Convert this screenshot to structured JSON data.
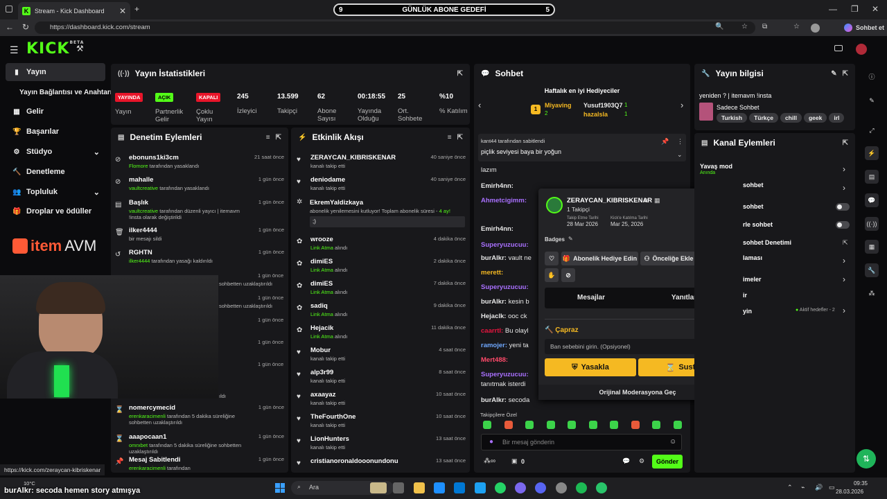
{
  "browser": {
    "tab_title": "Stream - Kick Dashboard",
    "url": "https://dashboard.kick.com/stream",
    "profile_label": "Sohbet et",
    "goal": {
      "left": "9",
      "title": "GÜNLÜK ABONE GEDEFİ",
      "right": "5"
    },
    "status_link": "https://kick.com/zeraycan-kibriskenar"
  },
  "header": {
    "logo": "KICK",
    "beta": "BETA"
  },
  "sidebar": {
    "items": [
      {
        "label": "Yayın",
        "icon": "broadcast-icon"
      },
      {
        "label": "Yayın Bağlantısı ve Anahtarı",
        "icon": ""
      },
      {
        "label": "Gelir",
        "icon": "revenue-icon"
      },
      {
        "label": "Başarılar",
        "icon": "trophy-icon"
      },
      {
        "label": "Stüdyo",
        "icon": "studio-icon"
      },
      {
        "label": "Denetleme",
        "icon": "hammer-icon"
      },
      {
        "label": "Topluluk",
        "icon": "community-icon"
      },
      {
        "label": "Droplar ve ödüller",
        "icon": "gift-icon"
      }
    ],
    "brand_pre": "item",
    "brand_post": "AVM"
  },
  "stats": {
    "title": "Yayın İstatistikleri",
    "items": [
      {
        "badge": "YAYINDA",
        "label": "Yayın"
      },
      {
        "badge": "AÇIK",
        "label": "Partnerlik Gelir"
      },
      {
        "badge": "KAPALI",
        "label": "Çoklu Yayın"
      },
      {
        "value": "245",
        "label": "İzleyici"
      },
      {
        "value": "13.599",
        "label": "Takipçi"
      },
      {
        "value": "62",
        "label": "Abone Sayısı"
      },
      {
        "value": "00:18:55",
        "label": "Yayında Olduğu"
      },
      {
        "value": "25",
        "label": "Ort. Sohbete"
      },
      {
        "value": "%10",
        "label": "% Katılım"
      }
    ]
  },
  "moderation": {
    "title": "Denetim Eylemleri",
    "rows": [
      {
        "name": "ebonuns1ki3cm",
        "by": "Flomore",
        "rest": "tarafından yasaklandı",
        "time": "21 saat önce",
        "icon": "ban-icon"
      },
      {
        "name": "mahalle",
        "by": "vaultcreative",
        "rest": "tarafından yasaklandı",
        "time": "1 gün önce",
        "icon": "ban-icon"
      },
      {
        "name": "Başlık",
        "by": "vaultcreative",
        "rest": "tarafından düzenli yayıcı | itemavm !insta olarak değiştirildi",
        "time": "1 gün önce",
        "icon": "title-icon"
      },
      {
        "name": "ilker4444",
        "by": "",
        "rest": "bir mesajı sildi",
        "time": "1 gün önce",
        "icon": "trash-icon"
      },
      {
        "name": "RGHTN",
        "by": "ilker4444",
        "rest": "tarafından yasağı kaldırıldı",
        "time": "1 gün önce",
        "icon": "unban-icon"
      },
      {
        "name": "nomercymecid",
        "by": "erenkaracimenli",
        "rest": "tarafından 5 dakika süreliğine sohbetten uzaklaştırıldı",
        "time": "1 gün önce",
        "icon": "hourglass-icon"
      },
      {
        "name": "aaapocaan1",
        "by": "omrxbet",
        "rest": "tarafından 5 dakika süreliğine sohbetten uzaklaştırıldı",
        "time": "1 gün önce",
        "icon": "hourglass-icon"
      },
      {
        "name": "Mesaj Sabitlendi",
        "by": "erenkaracimenli",
        "rest": "tarafından",
        "time": "1 gün önce",
        "icon": "pin-icon"
      }
    ],
    "partial_times": [
      "1 gün önce",
      "1 gün önce",
      "1 gün önce",
      "1 gün önce",
      "1 gün önce"
    ],
    "partial_texts": [
      "sohbetten uzaklaştırıldı",
      "sohbetten uzaklaştırıldı",
      "ıldı"
    ]
  },
  "activity": {
    "title": "Etkinlik Akışı",
    "rows": [
      {
        "name": "ZERAYCAN_KIBRISKENAR",
        "sub": "kanalı takip etti",
        "time": "40 saniye önce",
        "icon": "heart-icon",
        "green": false
      },
      {
        "name": "deniodame",
        "sub": "kanalı takip etti",
        "time": "40 saniye önce",
        "icon": "heart-icon",
        "green": false
      },
      {
        "name": "wrooze",
        "sub": "Link Atma",
        "sub2": "alındı",
        "time": "4 dakika önce",
        "icon": "redeem-icon",
        "green": true
      },
      {
        "name": "dimiES",
        "sub": "Link Atma",
        "sub2": "alındı",
        "time": "2 dakika önce",
        "icon": "redeem-icon",
        "green": true
      },
      {
        "name": "dimiES",
        "sub": "Link Atma",
        "sub2": "alındı",
        "time": "7 dakika önce",
        "icon": "redeem-icon",
        "green": true
      },
      {
        "name": "sadiq",
        "sub": "Link Atma",
        "sub2": "alındı",
        "time": "9 dakika önce",
        "icon": "redeem-icon",
        "green": true
      },
      {
        "name": "Hejacik",
        "sub": "Link Atma",
        "sub2": "alındı",
        "time": "11 dakika önce",
        "icon": "redeem-icon",
        "green": true
      },
      {
        "name": "Mobur",
        "sub": "kanalı takip etti",
        "time": "4 saat önce",
        "icon": "heart-icon",
        "green": false
      },
      {
        "name": "alp3r99",
        "sub": "kanalı takip etti",
        "time": "8 saat önce",
        "icon": "heart-icon",
        "green": false
      },
      {
        "name": "axaayaz",
        "sub": "kanalı takip etti",
        "time": "10 saat önce",
        "icon": "heart-icon",
        "green": false
      },
      {
        "name": "TheFourthOne",
        "sub": "kanalı takip etti",
        "time": "10 saat önce",
        "icon": "heart-icon",
        "green": false
      },
      {
        "name": "LionHunters",
        "sub": "kanalı takip etti",
        "time": "13 saat önce",
        "icon": "heart-icon",
        "green": false
      },
      {
        "name": "cristianoronaldooonundonu",
        "sub": "",
        "time": "13 saat önce",
        "icon": "heart-icon",
        "green": false
      }
    ],
    "sub_event": {
      "name": "EkremYaldizkaya",
      "text": "abonelik yenilemesini kutluyor! Toplam abonelik süresi -",
      "months": "4 ay!",
      "message": ";)"
    }
  },
  "chat": {
    "title": "Sohbet",
    "gifters_title": "Haftalık en iyi Hediyeciler",
    "gifters": [
      {
        "name": "Miyaving",
        "count": "2"
      },
      {
        "name": "Yusuf1903Q7",
        "count": "1"
      },
      {
        "name": "hazalsla",
        "count": "1"
      }
    ],
    "pinned_by": "kant44 tarafından sabitlendi",
    "pinned_msg": "piçlik seviyesi baya bir yoğun",
    "lines": [
      {
        "user": "",
        "text": "lazım",
        "color": "#e8e8e8"
      },
      {
        "user": "Emirh4nn:",
        "text": "",
        "color": "#e8e8e8"
      },
      {
        "user": "Ahmetcigimm:",
        "text": "",
        "color": "#a970ff"
      },
      {
        "user": "",
        "text": "",
        "color": "#e8e8e8"
      },
      {
        "user": "Emirh4nn:",
        "text": "",
        "color": "#e8e8e8"
      },
      {
        "user": "Superyuzucuu:",
        "text": "",
        "color": "#a970ff"
      },
      {
        "user": "burAlkr:",
        "text": "vault ne",
        "color": "#e8e8e8"
      },
      {
        "user": "merett:",
        "text": "",
        "color": "#f5b922"
      },
      {
        "user": "Superyuzucuu:",
        "text": "",
        "color": "#a970ff"
      },
      {
        "user": "burAlkr:",
        "text": "kesin b",
        "color": "#e8e8e8"
      },
      {
        "user": "Hejaclk:",
        "text": "ooc ck",
        "color": "#e8e8e8"
      },
      {
        "user": "caarrtl:",
        "text": "Bu olayl",
        "color": "#e8153f"
      },
      {
        "user": "ramojer:",
        "text": "yeni ta",
        "color": "#6fa8ff"
      },
      {
        "user": "Mert488:",
        "text": "",
        "color": "#ff4a6a"
      },
      {
        "user": "Superyuzucuu:",
        "text": "",
        "color": "#a970ff"
      },
      {
        "user": "",
        "text": "tanıtmak isterdi",
        "color": "#e8e8e8"
      },
      {
        "user": "burAlkr:",
        "text": "secoda",
        "color": "#e8e8e8"
      }
    ],
    "follower_only": "Takipçilere Özel",
    "input_placeholder": "Bir mesaj gönderin",
    "points": "0",
    "send_label": "Gönder"
  },
  "popup": {
    "username": "ZERAYCAN_KIBRISKENAR",
    "followers": "1 Takipçi",
    "follow_date_label": "Takip Etme Tarihi",
    "follow_date": "28 Mar 2026",
    "join_date_label": "Kick'e Katılma Tarihi",
    "join_date": "Mar 25, 2026",
    "badges_label": "Badges",
    "gift_sub": "Abonelik Hediye Edin",
    "prioritize": "Önceliğe Ekle",
    "tab_messages": "Mesajlar",
    "tab_replies": "Yanıtlar",
    "cross_label": "Çapraz",
    "reason_placeholder": "Ban sebebini girin. (Opsiyonel)",
    "ban": "Yasakla",
    "timeout": "Sustur",
    "original_mod": "Orijinal Moderasyona Geç"
  },
  "stream_info": {
    "title": "Yayın bilgisi",
    "stream_title": "yeniden ? | itemavm !insta",
    "category": "Sadece Sohbet",
    "tags": [
      "Turkish",
      "Türkçe",
      "chill",
      "geek",
      "irl"
    ]
  },
  "channel_actions": {
    "title": "Kanal Eylemleri",
    "slow_mode": "Yavaş mod",
    "slow_sub": "Anında",
    "items": [
      "sohbet",
      "sohbet",
      "rle sohbet",
      "sohbet Denetimi",
      "laması",
      "imeler",
      "ir",
      "yin"
    ],
    "goals": "Aktif hedefler - 2"
  },
  "overlay": {
    "subtitle": "burAlkr: secoda hemen story atmışya"
  },
  "taskbar": {
    "weather": "10°C",
    "search": "Ara",
    "time": "09:35",
    "date": "28.03.2026"
  }
}
